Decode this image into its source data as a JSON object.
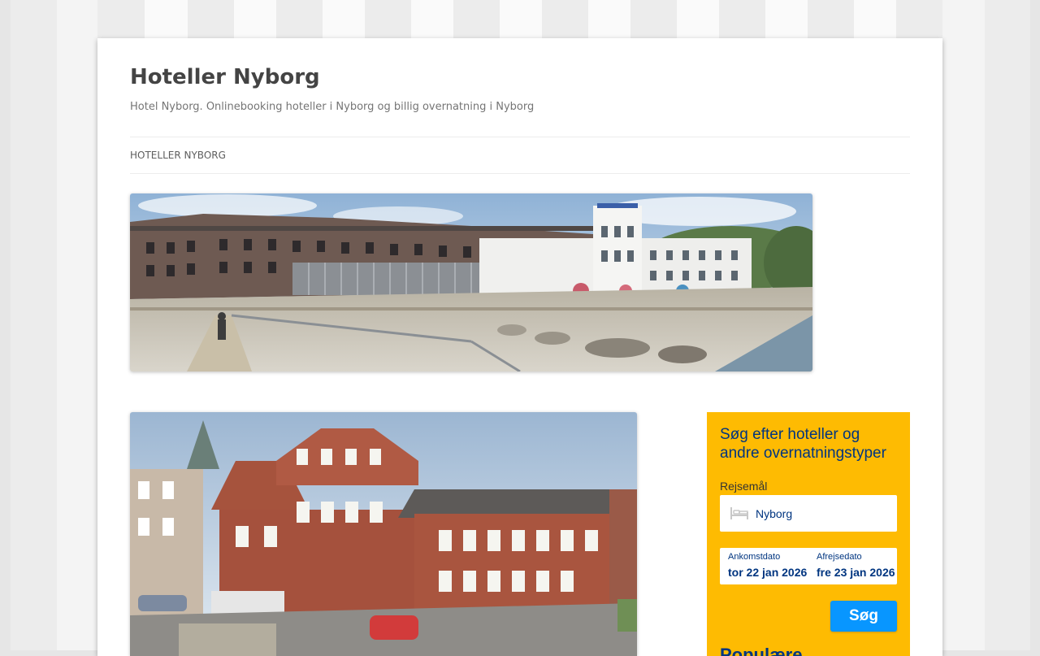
{
  "site": {
    "title": "Hoteller Nyborg",
    "description": "Hotel Nyborg. Onlinebooking hoteller i Nyborg og billig overnatning i Nyborg"
  },
  "nav": {
    "items": [
      {
        "label": "HOTELLER NYBORG"
      }
    ]
  },
  "widget": {
    "title": "Søg efter hoteller og andre overnatningstyper",
    "destination_label": "Rejsemål",
    "destination_value": "Nyborg",
    "checkin_label": "Ankomstdato",
    "checkin_value": "tor 22 jan 2026",
    "checkout_label": "Afrejsedato",
    "checkout_value": "fre 23 jan 2026",
    "search_button": "Søg",
    "more_heading": "Populære"
  },
  "colors": {
    "widget_bg": "#febb02",
    "widget_text": "#003580",
    "button": "#0896ff"
  },
  "icons": {
    "destination": "bed-icon"
  }
}
